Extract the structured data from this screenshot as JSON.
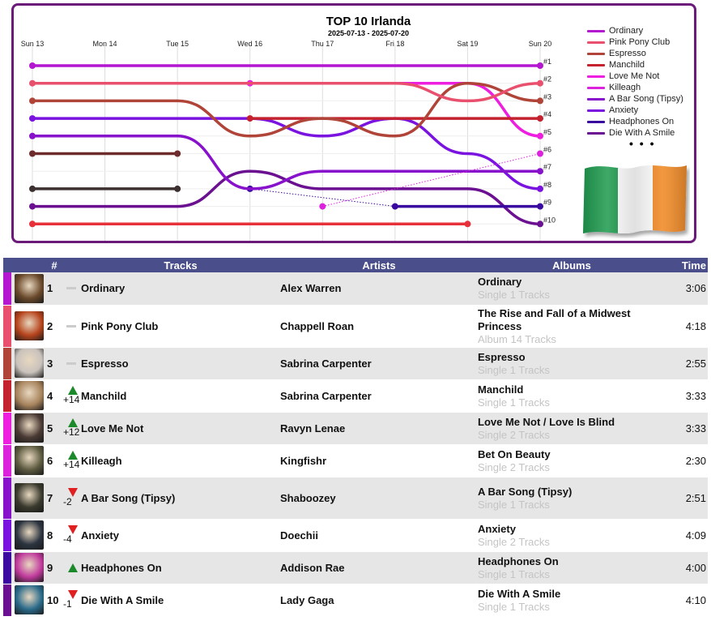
{
  "chart_data": {
    "type": "line",
    "title": "TOP 10 Irlanda",
    "subtitle": "2025-07-13 - 2025-07-20",
    "x": [
      "Sun 13",
      "Mon 14",
      "Tue 15",
      "Wed 16",
      "Thu 17",
      "Fri 18",
      "Sat 19",
      "Sun 20"
    ],
    "rank_labels": [
      "#1",
      "#2",
      "#3",
      "#4",
      "#5",
      "#6",
      "#7",
      "#8",
      "#9",
      "#10"
    ],
    "ylim": [
      1,
      10
    ],
    "y_inverted": true,
    "grid": true,
    "legend_position": "right",
    "legend_more": "• • •",
    "series": [
      {
        "name": "Ordinary",
        "color": "#b417d0",
        "values": [
          1,
          1,
          1,
          1,
          1,
          1,
          1,
          1
        ]
      },
      {
        "name": "Pink Pony Club",
        "color": "#e8506e",
        "values": [
          2,
          2,
          2,
          2,
          2,
          2,
          3,
          2
        ]
      },
      {
        "name": "Espresso",
        "color": "#b04438",
        "values": [
          3,
          3,
          3,
          5,
          4,
          5,
          2,
          3
        ]
      },
      {
        "name": "Manchild",
        "color": "#c4222f",
        "values": [
          null,
          null,
          null,
          4,
          4,
          4,
          4,
          4
        ]
      },
      {
        "name": "Love Me Not",
        "color": "#ee1ee0",
        "values": [
          null,
          null,
          null,
          2,
          2,
          2,
          2,
          5
        ]
      },
      {
        "name": "Killeagh",
        "color": "#dd22dd",
        "values": [
          null,
          null,
          null,
          null,
          9,
          null,
          null,
          6
        ]
      },
      {
        "name": "A Bar Song (Tipsy)",
        "color": "#8811cc",
        "values": [
          5,
          5,
          5,
          8,
          7,
          7,
          7,
          7
        ]
      },
      {
        "name": "Anxiety",
        "color": "#7a12e0",
        "values": [
          4,
          4,
          4,
          4,
          5,
          4,
          6,
          8
        ]
      },
      {
        "name": "Headphones On",
        "color": "#3a0aa0",
        "values": [
          null,
          null,
          null,
          8,
          null,
          9,
          9,
          9
        ]
      },
      {
        "name": "Die With A Smile",
        "color": "#6a1090",
        "values": [
          9,
          9,
          9,
          7,
          8,
          8,
          8,
          10
        ]
      }
    ],
    "other_lines": [
      {
        "color": "#6e2c2c",
        "values": [
          6,
          6,
          6,
          null,
          null,
          null,
          null,
          null
        ]
      },
      {
        "color": "#3d3030",
        "values": [
          8,
          8,
          8,
          null,
          null,
          null,
          null,
          null
        ]
      },
      {
        "color": "#e8303a",
        "values": [
          10,
          10,
          10,
          10,
          10,
          10,
          10,
          null
        ]
      }
    ]
  },
  "flag": {
    "colors": [
      "#1c9a4e",
      "#ffffff",
      "#f08a28"
    ]
  },
  "table": {
    "headers": {
      "num": "#",
      "tracks": "Tracks",
      "artists": "Artists",
      "albums": "Albums",
      "time": "Time"
    },
    "rows": [
      {
        "rank": "1",
        "trend": "same",
        "delta": "",
        "track": "Ordinary",
        "artist": "Alex Warren",
        "album": "Ordinary",
        "album_meta": "Single 1 Tracks",
        "time": "3:06",
        "color": "#b417d0",
        "cover": "#6b4a2c"
      },
      {
        "rank": "2",
        "trend": "same",
        "delta": "",
        "track": "Pink Pony Club",
        "artist": "Chappell Roan",
        "album": "The Rise and Fall of a Midwest Princess",
        "album_meta": "Album 14 Tracks",
        "time": "4:18",
        "color": "#e8506e",
        "cover": "#b6441c"
      },
      {
        "rank": "3",
        "trend": "same",
        "delta": "",
        "track": "Espresso",
        "artist": "Sabrina Carpenter",
        "album": "Espresso",
        "album_meta": "Single 1 Tracks",
        "time": "2:55",
        "color": "#b04438",
        "cover": "#c9c2bc"
      },
      {
        "rank": "4",
        "trend": "up",
        "delta": "+14",
        "track": "Manchild",
        "artist": "Sabrina Carpenter",
        "album": "Manchild",
        "album_meta": "Single 1 Tracks",
        "time": "3:33",
        "color": "#c4222f",
        "cover": "#a8845e"
      },
      {
        "rank": "5",
        "trend": "up",
        "delta": "+12",
        "track": "Love Me Not",
        "artist": "Ravyn Lenae",
        "album": "Love Me Not / Love Is Blind",
        "album_meta": "Single 2 Tracks",
        "time": "3:33",
        "color": "#ee1ee0",
        "cover": "#4a3a34"
      },
      {
        "rank": "6",
        "trend": "up",
        "delta": "+14",
        "track": "Killeagh",
        "artist": "Kingfishr",
        "album": "Bet On Beauty",
        "album_meta": "Single 2 Tracks",
        "time": "2:30",
        "color": "#dd22dd",
        "cover": "#5c5a40"
      },
      {
        "rank": "7",
        "trend": "down",
        "delta": "-2",
        "track": "A Bar Song (Tipsy)",
        "artist": "Shaboozey",
        "album": "A Bar Song (Tipsy)",
        "album_meta": "Single 1 Tracks",
        "time": "2:51",
        "color": "#8811cc",
        "cover": "#3a3a2e"
      },
      {
        "rank": "8",
        "trend": "down",
        "delta": "-4",
        "track": "Anxiety",
        "artist": "Doechii",
        "album": "Anxiety",
        "album_meta": "Single 2 Tracks",
        "time": "4:09",
        "color": "#7a12e0",
        "cover": "#2c3440"
      },
      {
        "rank": "9",
        "trend": "up",
        "delta": "",
        "track": "Headphones On",
        "artist": "Addison Rae",
        "album": "Headphones On",
        "album_meta": "Single 1 Tracks",
        "time": "4:00",
        "color": "#3a0aa0",
        "cover": "#c03a9c"
      },
      {
        "rank": "10",
        "trend": "down",
        "delta": "-1",
        "track": "Die With A Smile",
        "artist": "Lady Gaga",
        "album": "Die With A Smile",
        "album_meta": "Single 1 Tracks",
        "time": "4:10",
        "color": "#6a1090",
        "cover": "#2a6a8a"
      }
    ]
  }
}
